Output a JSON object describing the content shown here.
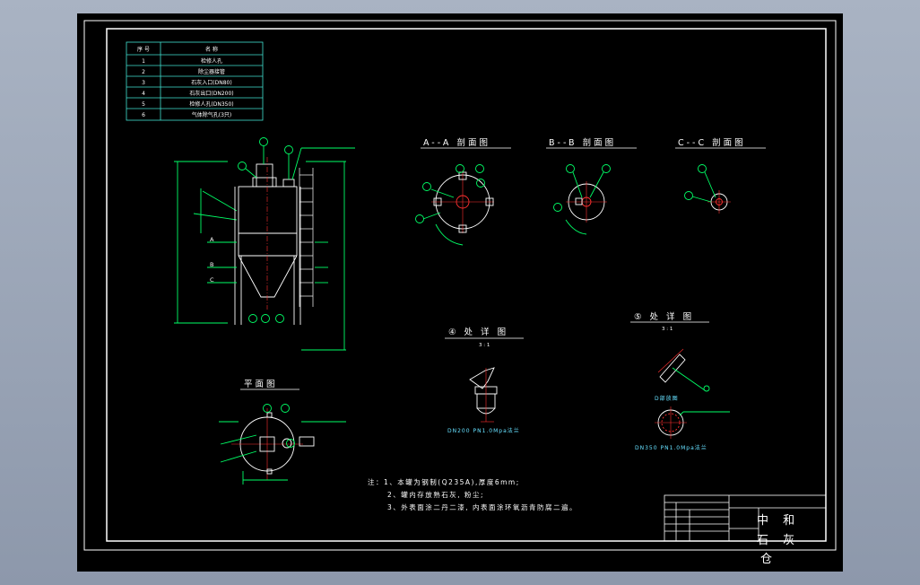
{
  "parts_table": {
    "headers": [
      "序 号",
      "名 称"
    ],
    "rows": [
      [
        "1",
        "检修人孔"
      ],
      [
        "2",
        "除尘器接管"
      ],
      [
        "3",
        "石灰入口(DN80)"
      ],
      [
        "4",
        "石灰出口(DN200)"
      ],
      [
        "5",
        "检修人孔(DN350)"
      ],
      [
        "6",
        "气体除气孔(3只)"
      ]
    ]
  },
  "views": {
    "aa": "A--A 剖面图",
    "bb": "B--B 剖面图",
    "cc": "C--C 剖面图",
    "plan": "平面图",
    "detail4": "④ 处 详 图",
    "detail5": "⑤ 处 详 图",
    "scale4": "3 : 1",
    "scale5": "3 : 1"
  },
  "labels": {
    "a": "A",
    "b": "B",
    "c": "C",
    "flange4": "DN200 PN1.0Mpa法兰",
    "flange5": "DN350 PN1.0Mpa法兰",
    "manhole": "D部放图"
  },
  "notes": [
    "注：1、本罐为钢制(Q235A),厚度6mm;",
    "2、罐内存放熟石灰, 粉尘;",
    "3、外表面涂二丹二漆, 内表面涂环氧沥青防腐二遍。"
  ],
  "title_block": {
    "name_line1": "中 和",
    "name_line2": "石 灰",
    "name_line3": "仓"
  },
  "colors": {
    "background": "#000000",
    "frame": "#ffffff",
    "table": "#40e0d0",
    "leader": "#00ff66",
    "center": "#ff3030"
  }
}
